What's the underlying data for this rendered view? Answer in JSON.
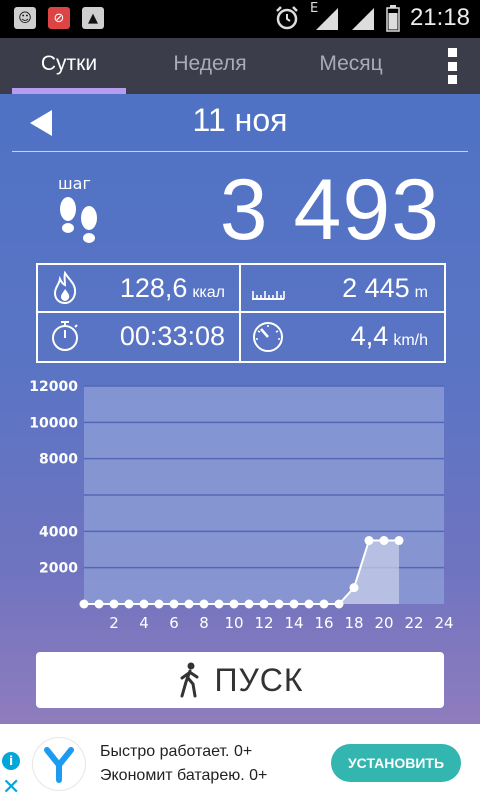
{
  "status_bar": {
    "time": "21:18",
    "network_label": "E",
    "icons": [
      "message-icon",
      "blocked-app-icon",
      "image-icon",
      "alarm-icon",
      "signal-icon",
      "signal-icon",
      "battery-icon"
    ]
  },
  "tabs": [
    {
      "label": "Сутки",
      "active": true
    },
    {
      "label": "Неделя",
      "active": false
    },
    {
      "label": "Месяц",
      "active": false
    }
  ],
  "date": "11 ноя",
  "steps": {
    "label": "шаг",
    "count": "3 493"
  },
  "stats": {
    "calories": {
      "value": "128,6",
      "unit": "ккал"
    },
    "distance": {
      "value": "2 445",
      "unit": "m"
    },
    "duration": {
      "value": "00:33:08",
      "unit": ""
    },
    "speed": {
      "value": "4,4",
      "unit": "km/h"
    }
  },
  "chart_data": {
    "type": "area",
    "title": "",
    "xlabel": "",
    "ylabel": "",
    "x": [
      0,
      1,
      2,
      3,
      4,
      5,
      6,
      7,
      8,
      9,
      10,
      11,
      12,
      13,
      14,
      15,
      16,
      17,
      18,
      19,
      20,
      21
    ],
    "values": [
      0,
      0,
      0,
      0,
      0,
      0,
      0,
      0,
      0,
      0,
      0,
      0,
      0,
      0,
      0,
      0,
      0,
      0,
      900,
      3493,
      3493,
      3493
    ],
    "xticks": [
      "2",
      "4",
      "6",
      "8",
      "10",
      "12",
      "14",
      "16",
      "18",
      "20",
      "22",
      "24"
    ],
    "yticks": [
      "2000",
      "4000",
      "8000",
      "10000",
      "12000"
    ],
    "ylim": [
      0,
      12000
    ],
    "xlim": [
      0,
      24
    ],
    "grid": true,
    "colors": {
      "line": "#ffffff",
      "fill": "#c7cde8",
      "plot_bg": "#8c9ed6"
    }
  },
  "start_button": {
    "label": "ПУСК"
  },
  "ad": {
    "line1": "Быстро работает. 0+",
    "line2": "Экономит батарею. 0+",
    "button": "УСТАНОВИТЬ",
    "info_symbol": "i",
    "close_symbol": "✕"
  },
  "colors": {
    "tab_bar": "#3b3e4a",
    "tab_indicator": "#b89cf0",
    "ad_button": "#33b6b0"
  }
}
